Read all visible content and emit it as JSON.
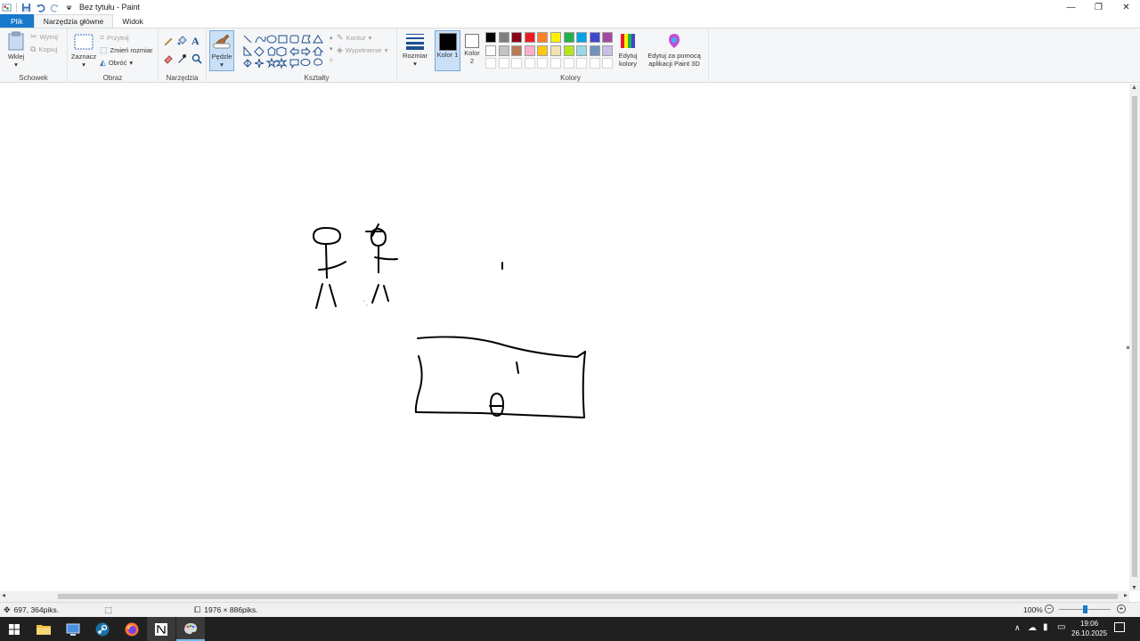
{
  "window": {
    "title": "Bez tytułu - Paint",
    "controls": {
      "minimize": "—",
      "maximize": "❐",
      "close": "✕"
    }
  },
  "tabs": [
    "Plik",
    "Narzędzia główne",
    "Widok"
  ],
  "ribbon": {
    "clipboard": {
      "label": "Schowek",
      "paste": "Wklej",
      "cut": "Wytnij",
      "copy": "Kopiuj"
    },
    "image": {
      "label": "Obraz",
      "select": "Zaznacz",
      "crop": "Przytnij",
      "resize": "Zmień rozmiar",
      "rotate": "Obróć"
    },
    "tools": {
      "label": "Narzędzia"
    },
    "brushes": {
      "label": "Pędzle"
    },
    "shapes": {
      "label": "Kształty",
      "outline": "Kontur",
      "fill": "Wypełnienie"
    },
    "size": {
      "label": "Rozmiar"
    },
    "colors": {
      "label": "Kolory",
      "color1": "Kolor 1",
      "color2": "Kolor 2",
      "edit": "Edytuj kolory",
      "paint3d": "Edytuj za pomocą aplikacji Paint 3D",
      "color1_value": "#000000",
      "color2_value": "#ffffff",
      "palette_row1": [
        "#000000",
        "#7f7f7f",
        "#880015",
        "#ed1c24",
        "#ff7f27",
        "#fff200",
        "#22b14c",
        "#00a2e8",
        "#3f48cc",
        "#a349a4"
      ],
      "palette_row2": [
        "#ffffff",
        "#c3c3c3",
        "#b97a57",
        "#ffaec9",
        "#ffc90e",
        "#efe4b0",
        "#b5e61d",
        "#99d9ea",
        "#7092be",
        "#c8bfe7"
      ]
    }
  },
  "status": {
    "cursor_pos": "697, 364piks.",
    "canvas_size": "1976 × 886piks.",
    "zoom": "100%",
    "zoom_level": 0.5
  },
  "taskbar": {
    "time": "19:06",
    "date": "26.10.2025"
  }
}
